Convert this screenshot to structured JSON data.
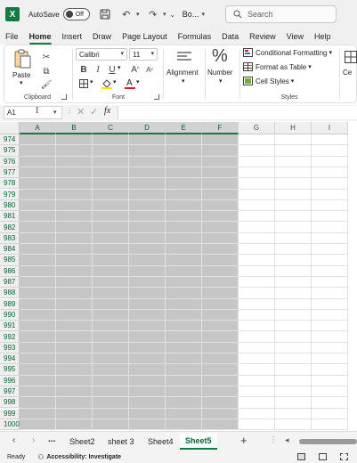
{
  "titlebar": {
    "logo_letter": "X",
    "autosave_label": "AutoSave",
    "autosave_state": "Off",
    "filename": "Bo...",
    "search_placeholder": "Search"
  },
  "menu": {
    "tabs": [
      "File",
      "Home",
      "Insert",
      "Draw",
      "Page Layout",
      "Formulas",
      "Data",
      "Review",
      "View",
      "Help"
    ],
    "active": "Home"
  },
  "ribbon": {
    "clipboard": {
      "paste_label": "Paste",
      "group_label": "Clipboard"
    },
    "font": {
      "font_name": "Calibri",
      "font_size": "11",
      "group_label": "Font",
      "bold": "B",
      "italic": "I",
      "underline": "U",
      "grow": "A",
      "shrink": "A"
    },
    "alignment": {
      "label": "Alignment"
    },
    "number": {
      "label": "Number",
      "symbol": "%"
    },
    "styles": {
      "conditional": "Conditional Formatting",
      "format_table": "Format as Table",
      "cell_styles": "Cell Styles",
      "group_label": "Styles"
    },
    "cells_partial": "Ce"
  },
  "formula_bar": {
    "name_box": "A1",
    "fx": "fx"
  },
  "grid": {
    "columns": [
      "A",
      "B",
      "C",
      "D",
      "E",
      "F",
      "G",
      "H",
      "I"
    ],
    "selected_columns": [
      "A",
      "B",
      "C",
      "D",
      "E",
      "F"
    ],
    "rows": [
      "974",
      "975",
      "976",
      "977",
      "978",
      "979",
      "980",
      "981",
      "982",
      "983",
      "984",
      "985",
      "986",
      "987",
      "988",
      "989",
      "990",
      "991",
      "992",
      "993",
      "994",
      "995",
      "996",
      "997",
      "998",
      "999",
      "1000"
    ]
  },
  "sheets": {
    "more": "...",
    "tabs": [
      "Sheet2",
      "sheet 3",
      "Sheet4",
      "Sheet5"
    ],
    "active": "Sheet5",
    "add": "+"
  },
  "status": {
    "ready": "Ready",
    "accessibility": "Accessibility: Investigate"
  },
  "colors": {
    "accent": "#107c41",
    "selection": "#c6c6c6"
  }
}
